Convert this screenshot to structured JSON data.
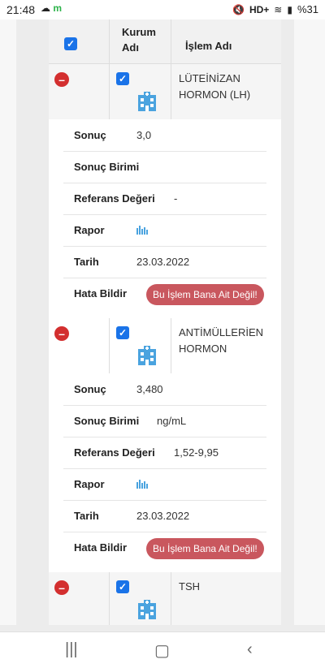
{
  "status_bar": {
    "time": "21:48",
    "network": "HD+",
    "battery": "%31",
    "icons": [
      "cloud-icon",
      "app-icon",
      "mute-icon",
      "wifi-icon",
      "signal-icon",
      "battery-icon"
    ]
  },
  "table": {
    "header": {
      "col_institution": "Kurum Adı",
      "col_procedure": "İşlem Adı"
    },
    "records": [
      {
        "procedure": "LÜTEİNİZAN HORMON (LH)",
        "details": {
          "result_label": "Sonuç",
          "result_value": "3,0",
          "unit_label": "Sonuç Birimi",
          "unit_value": "",
          "ref_label": "Referans Değeri",
          "ref_value": "-",
          "report_label": "Rapor",
          "date_label": "Tarih",
          "date_value": "23.03.2022",
          "error_label": "Hata Bildir",
          "error_button": "Bu İşlem Bana Ait Değil!"
        }
      },
      {
        "procedure": "ANTİMÜLLERİEN HORMON",
        "details": {
          "result_label": "Sonuç",
          "result_value": "3,480",
          "unit_label": "Sonuç Birimi",
          "unit_value": "ng/mL",
          "ref_label": "Referans Değeri",
          "ref_value": "1,52-9,95",
          "report_label": "Rapor",
          "date_label": "Tarih",
          "date_value": "23.03.2022",
          "error_label": "Hata Bildir",
          "error_button": "Bu İşlem Bana Ait Değil!"
        }
      },
      {
        "procedure": "TSH"
      }
    ]
  },
  "colors": {
    "checkbox": "#1a73e8",
    "remove": "#d32f2f",
    "error_button": "#c9575e",
    "icon_blue": "#4aa3df"
  }
}
